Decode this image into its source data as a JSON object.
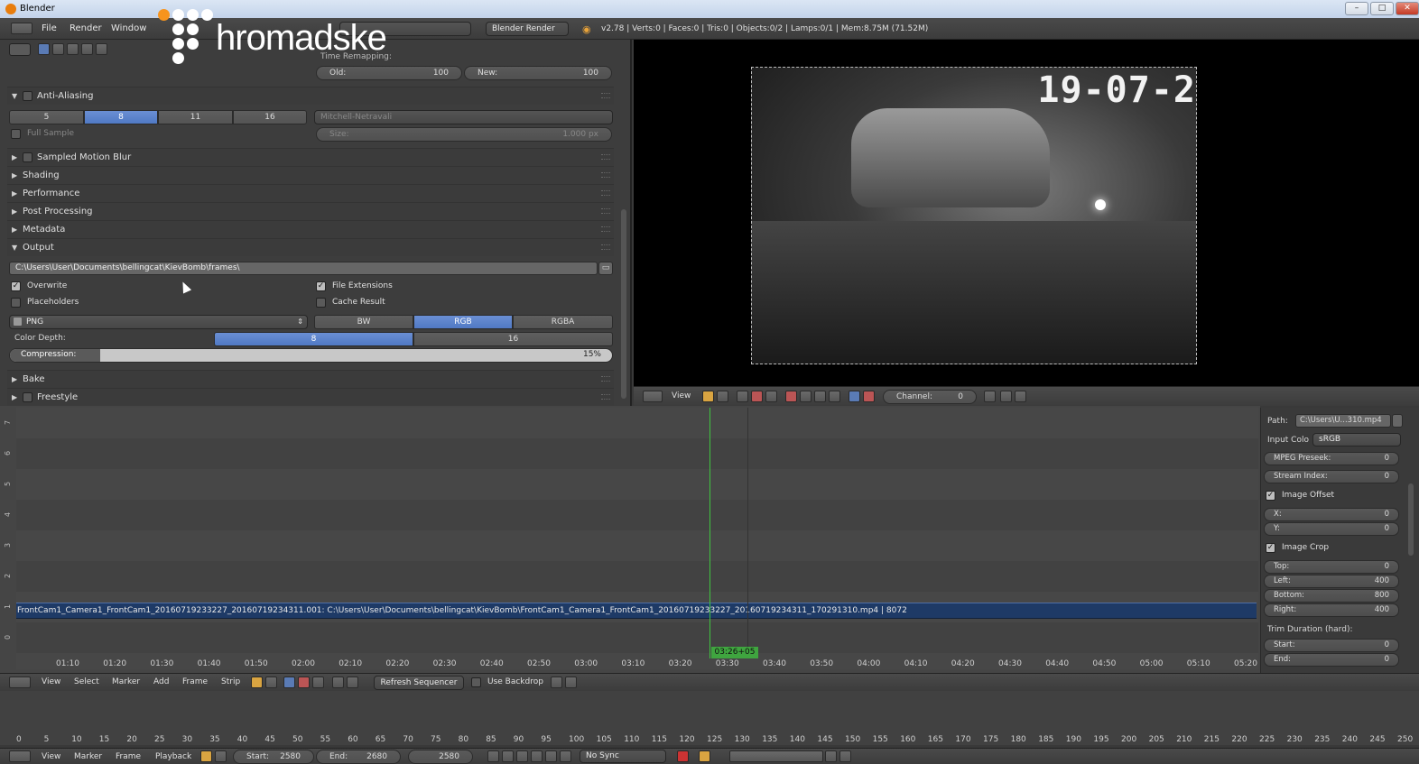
{
  "window": {
    "title": "Blender"
  },
  "menu": {
    "file": "File",
    "render": "Render",
    "window": "Window"
  },
  "engine": "Blender Render",
  "stats": "v2.78 | Verts:0 | Faces:0 | Tris:0 | Objects:0/2 | Lamps:0/1 | Mem:8.75M (71.52M)",
  "watermark": {
    "text": "hromadske",
    "dot_color": "#f7941d"
  },
  "time_remap": {
    "label": "Time Remapping:",
    "old_label": "Old:",
    "old_value": "100",
    "new_label": "New:",
    "new_value": "100"
  },
  "anti_aliasing": {
    "title": "Anti-Aliasing",
    "samples": [
      "5",
      "8",
      "11",
      "16"
    ],
    "selected": "8",
    "filter": "Mitchell-Netravali",
    "full_sample": "Full Sample",
    "size_label": "Size:",
    "size_value": "1.000 px"
  },
  "panels": {
    "sampled_motion_blur": "Sampled Motion Blur",
    "shading": "Shading",
    "performance": "Performance",
    "post_processing": "Post Processing",
    "metadata": "Metadata",
    "output": "Output",
    "bake": "Bake",
    "freestyle": "Freestyle"
  },
  "output": {
    "path": "C:\\Users\\User\\Documents\\bellingcat\\KievBomb\\frames\\",
    "overwrite": "Overwrite",
    "file_extensions": "File Extensions",
    "placeholders": "Placeholders",
    "cache_result": "Cache Result",
    "format": "PNG",
    "color_modes": [
      "BW",
      "RGB",
      "RGBA"
    ],
    "color_mode_selected": "RGB",
    "color_depth_label": "Color Depth:",
    "color_depths": [
      "8",
      "16"
    ],
    "color_depth_selected": "8",
    "compression_label": "Compression:",
    "compression_value": "15%",
    "compression_fraction": 0.15
  },
  "preview": {
    "date_stamp": "19-07-2"
  },
  "viewer_bar": {
    "view": "View",
    "channel_label": "Channel:",
    "channel_value": "0"
  },
  "sequencer": {
    "channels": [
      "0",
      "1",
      "2",
      "3",
      "4",
      "5",
      "6",
      "7"
    ],
    "strip_label": "FrontCam1_Camera1_FrontCam1_20160719233227_20160719234311.001: C:\\Users\\User\\Documents\\bellingcat\\KievBomb\\FrontCam1_Camera1_FrontCam1_20160719233227_20160719234311_170291310.mp4 | 8072",
    "current_time": "03:26+05",
    "ticks": [
      "01:10",
      "01:20",
      "01:30",
      "01:40",
      "01:50",
      "02:00",
      "02:10",
      "02:20",
      "02:30",
      "02:40",
      "02:50",
      "03:00",
      "03:10",
      "03:20",
      "03:30",
      "03:40",
      "03:50",
      "04:00",
      "04:10",
      "04:20",
      "04:30",
      "04:40",
      "04:50",
      "05:00",
      "05:10",
      "05:20"
    ]
  },
  "strip_props": {
    "path_label": "Path:",
    "path_value": "C:\\Users\\U...310.mp4",
    "input_color_label": "Input Colo",
    "input_color_value": "sRGB",
    "mpeg_preseek_label": "MPEG Preseek:",
    "mpeg_preseek_value": "0",
    "stream_index_label": "Stream Index:",
    "stream_index_value": "0",
    "image_offset": "Image Offset",
    "x_label": "X:",
    "x_value": "0",
    "y_label": "Y:",
    "y_value": "0",
    "image_crop": "Image Crop",
    "top_label": "Top:",
    "top_value": "0",
    "left_label": "Left:",
    "left_value": "400",
    "bottom_label": "Bottom:",
    "bottom_value": "800",
    "right_label": "Right:",
    "right_value": "400",
    "trim_label": "Trim Duration (hard):",
    "start_label": "Start:",
    "start_value": "0",
    "end_label": "End:",
    "end_value": "0"
  },
  "seq_header": {
    "view": "View",
    "select": "Select",
    "marker": "Marker",
    "add": "Add",
    "frame": "Frame",
    "strip": "Strip",
    "refresh": "Refresh Sequencer",
    "use_backdrop": "Use Backdrop"
  },
  "timeline": {
    "ticks": [
      "0",
      "5",
      "10",
      "15",
      "20",
      "25",
      "30",
      "35",
      "40",
      "45",
      "50",
      "55",
      "60",
      "65",
      "70",
      "75",
      "80",
      "85",
      "90",
      "95",
      "100",
      "105",
      "110",
      "115",
      "120",
      "125",
      "130",
      "135",
      "140",
      "145",
      "150",
      "155",
      "160",
      "165",
      "170",
      "175",
      "180",
      "185",
      "190",
      "195",
      "200",
      "205",
      "210",
      "215",
      "220",
      "225",
      "230",
      "235",
      "240",
      "245",
      "250"
    ]
  },
  "timeline_header": {
    "view": "View",
    "marker": "Marker",
    "frame": "Frame",
    "playback": "Playback",
    "start_label": "Start:",
    "start_value": "2580",
    "end_label": "End:",
    "end_value": "2680",
    "current_value": "2580",
    "sync": "No Sync"
  }
}
